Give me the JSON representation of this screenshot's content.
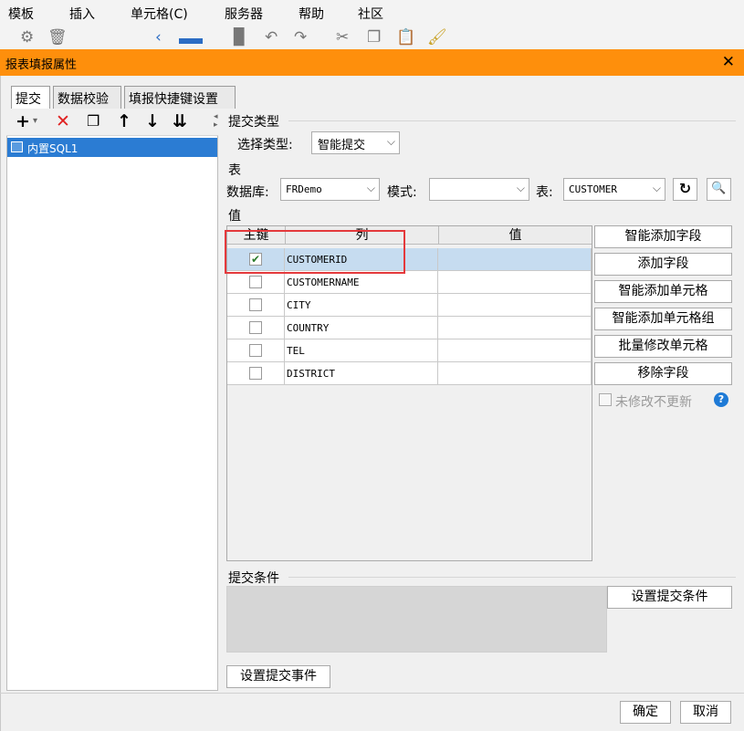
{
  "menubar": {
    "items": [
      "模板",
      "插入",
      "单元格(C)",
      "服务器",
      "帮助",
      "社区"
    ]
  },
  "dialog": {
    "title": "报表填报属性",
    "tabs": [
      "提交",
      "数据校验",
      "填报快捷键设置"
    ],
    "tree": {
      "item": "内置SQL1"
    },
    "submit_type": {
      "section": "提交类型",
      "label": "选择类型:",
      "value": "智能提交"
    },
    "table": {
      "section": "表",
      "db_label": "数据库:",
      "db_value": "FRDemo",
      "schema_label": "模式:",
      "schema_value": "",
      "table_label": "表:",
      "table_value": "CUSTOMER"
    },
    "values": {
      "section": "值",
      "headers": {
        "pk": "主键",
        "col": "列",
        "val": "值"
      },
      "rows": [
        {
          "pk": true,
          "col": "CUSTOMERID"
        },
        {
          "pk": false,
          "col": "CUSTOMERNAME"
        },
        {
          "pk": false,
          "col": "CITY"
        },
        {
          "pk": false,
          "col": "COUNTRY"
        },
        {
          "pk": false,
          "col": "TEL"
        },
        {
          "pk": false,
          "col": "DISTRICT"
        }
      ]
    },
    "side_buttons": [
      "智能添加字段",
      "添加字段",
      "智能添加单元格",
      "智能添加单元格组",
      "批量修改单元格",
      "移除字段"
    ],
    "unmodified_checkbox": "未修改不更新",
    "conditions": {
      "section": "提交条件",
      "button": "设置提交条件"
    },
    "event_button": "设置提交事件",
    "ok": "确定",
    "cancel": "取消",
    "colors": {
      "titlebar": "#fe8f0c",
      "selection": "#2b7cd3",
      "highlight_box": "#e4393c"
    }
  }
}
